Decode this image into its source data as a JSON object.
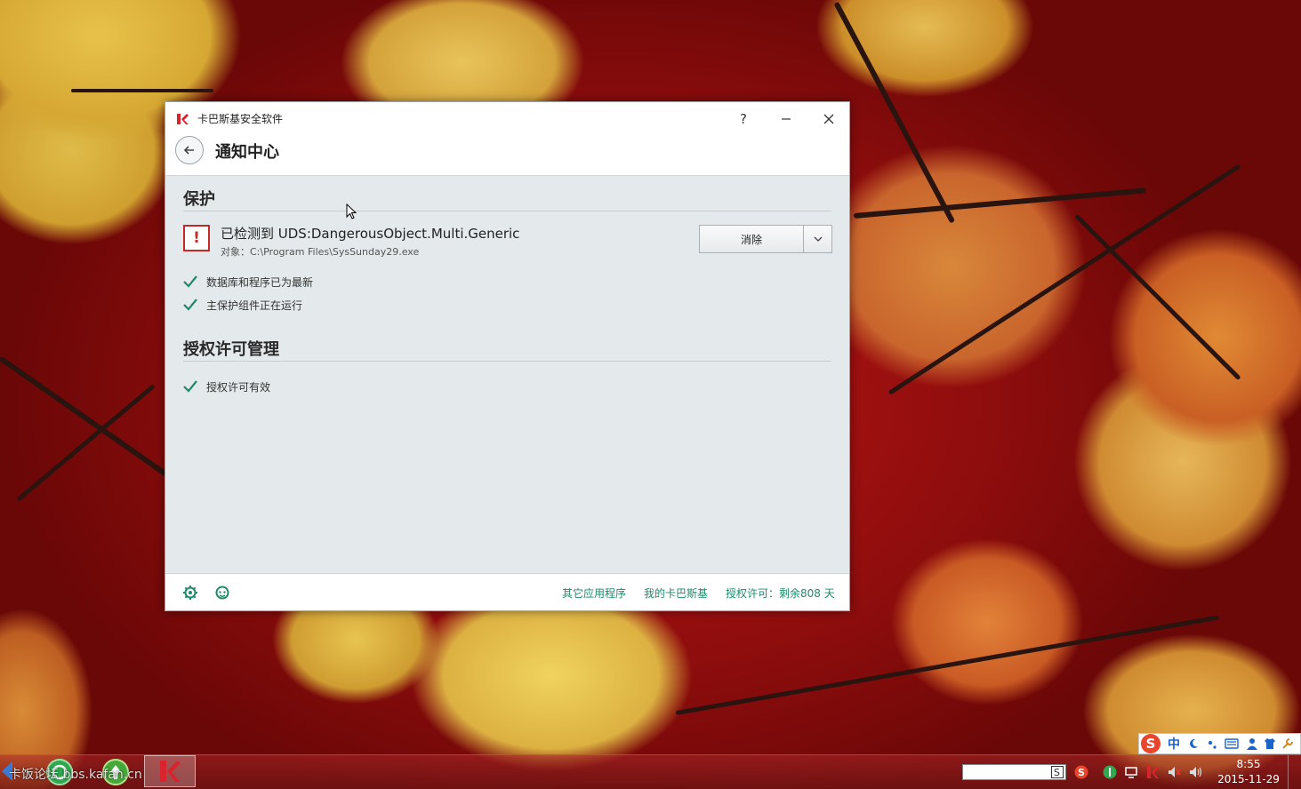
{
  "window": {
    "app_title": "卡巴斯基安全软件",
    "help_glyph": "?",
    "page_title": "通知中心"
  },
  "protection": {
    "section_title": "保护",
    "threat_title": "已检测到 UDS:DangerousObject.Multi.Generic",
    "threat_object": "对象：C:\\Program Files\\SysSunday29.exe",
    "action_label": "消除",
    "status_items": [
      "数据库和程序已为最新",
      "主保护组件正在运行"
    ]
  },
  "license": {
    "section_title": "授权许可管理",
    "status_items": [
      "授权许可有效"
    ]
  },
  "footer": {
    "links": [
      "其它应用程序",
      "我的卡巴斯基",
      "授权许可：剩余808 天"
    ]
  },
  "taskbar": {
    "watermark": "卡饭论坛 bbs.kafan.cn",
    "clock_time": "8:55",
    "clock_date": "2015-11-29"
  },
  "ime": {
    "logo": "S",
    "mode": "中"
  },
  "colors": {
    "accent_green": "#1e8a6a",
    "alert_red": "#c62828",
    "kaspersky_red": "#d9232d"
  }
}
